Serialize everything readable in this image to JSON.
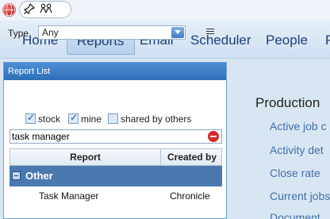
{
  "topbar": {
    "icons": [
      "globe-icon",
      "pin-icon",
      "people-icon"
    ]
  },
  "nav": {
    "items": [
      {
        "label": "Home"
      },
      {
        "label": "Reports",
        "active": true
      },
      {
        "label": "Email"
      },
      {
        "label": "Scheduler"
      },
      {
        "label": "People"
      },
      {
        "label": "P"
      }
    ]
  },
  "report_list": {
    "title": "Report List",
    "type_label": "Type",
    "type_value": "Any",
    "filters": [
      {
        "label": "stock",
        "checked": true
      },
      {
        "label": "mine",
        "checked": true
      },
      {
        "label": "shared by others",
        "checked": false
      }
    ],
    "search_value": "task manager",
    "columns": [
      "Report",
      "Created by"
    ],
    "groups": [
      {
        "name": "Other",
        "rows": [
          {
            "report": "Task Manager",
            "created_by": "Chronicle"
          }
        ]
      }
    ]
  },
  "main": {
    "title": "Production",
    "links": [
      "Active job c",
      "Activity det",
      "Close rate",
      "Current jobs",
      "Document"
    ]
  }
}
